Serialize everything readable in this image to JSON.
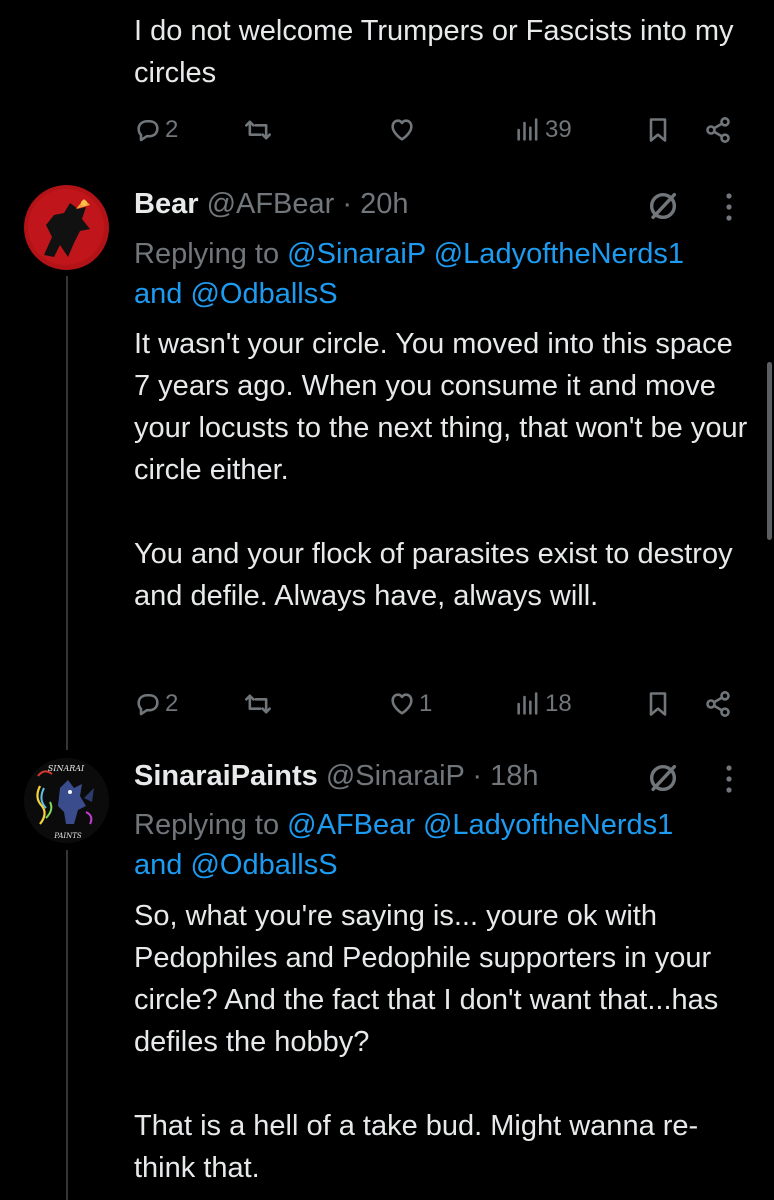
{
  "top_tweet": {
    "text": "I do not welcome Trumpers or Fascists into my circles",
    "actions": {
      "replies": "2",
      "retweets": "",
      "likes": "",
      "views": "39"
    }
  },
  "tweets": [
    {
      "name": "Bear",
      "handle": "@AFBear",
      "time": "· 20h",
      "replying_prefix": "Replying to",
      "replying_to": "@SinaraiP @LadyoftheNerds1",
      "replying_and": "and",
      "replying_last": "@OdballsS",
      "paragraphs": [
        "It wasn't your circle. You moved into this space 7 years ago.  When you consume it and move your locusts to the next thing, that won't be your circle either.",
        "You and your flock of parasites exist to destroy and defile.  Always have, always will."
      ],
      "actions": {
        "replies": "2",
        "retweets": "",
        "likes": "1",
        "views": "18"
      }
    },
    {
      "name": "SinaraiPaints",
      "handle": "@SinaraiP",
      "time": "· 18h",
      "replying_prefix": "Replying to",
      "replying_to": "@AFBear @LadyoftheNerds1",
      "replying_and": "and",
      "replying_last": "@OdballsS",
      "avatar_text_top": "SINARAI",
      "avatar_text_bottom": "PAINTS",
      "paragraphs": [
        "So, what you're saying is... youre ok with Pedophiles and Pedophile supporters in your circle? And the fact that I don't want that...has defiles the hobby?",
        "That is a hell of a take bud. Might wanna re-think that."
      ]
    }
  ],
  "colors": {
    "background": "#000000",
    "text": "#e7e9ea",
    "muted": "#71767b",
    "link": "#1d9bf0",
    "thread_line": "#333639"
  },
  "icons": [
    "reply-icon",
    "retweet-icon",
    "like-icon",
    "views-icon",
    "bookmark-icon",
    "share-icon",
    "grok-icon",
    "more-icon"
  ]
}
